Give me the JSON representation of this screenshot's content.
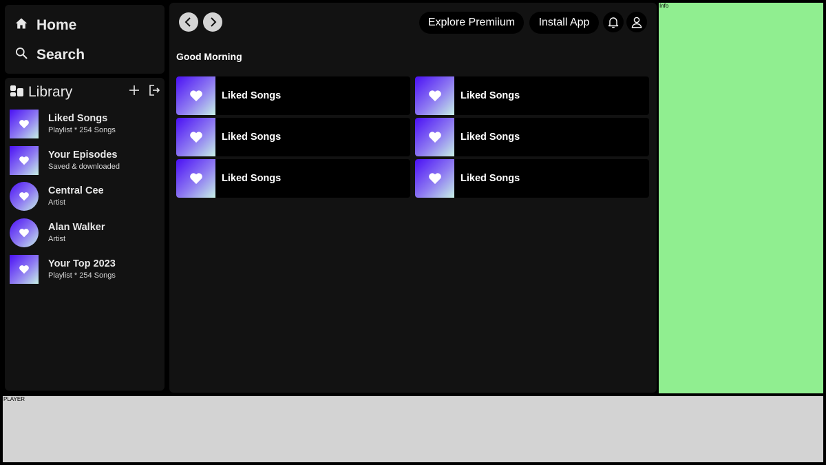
{
  "nav": {
    "home_label": "Home",
    "home_icon": "home-icon",
    "search_label": "Search",
    "search_icon": "search-icon"
  },
  "library": {
    "title": "Library",
    "icon": "library-icon",
    "actions": [
      "add-icon",
      "logout-icon"
    ],
    "items": [
      {
        "title": "Liked Songs",
        "subtitle": "Playlist * 254 Songs",
        "shape": "square"
      },
      {
        "title": "Your Episodes",
        "subtitle": "Saved & downloaded",
        "shape": "square"
      },
      {
        "title": "Central Cee",
        "subtitle": "Artist",
        "shape": "round"
      },
      {
        "title": "Alan Walker",
        "subtitle": "Artist",
        "shape": "round"
      },
      {
        "title": "Your Top 2023",
        "subtitle": "Playlist * 254 Songs",
        "shape": "square"
      }
    ]
  },
  "header": {
    "back_icon": "chevron-left-icon",
    "forward_icon": "chevron-right-icon",
    "explore_label": "Explore Premiium",
    "install_label": "Install App",
    "bell_icon": "bell-icon",
    "user_icon": "user-icon"
  },
  "main": {
    "greeting": "Good Morning",
    "cards": [
      {
        "label": "Liked Songs"
      },
      {
        "label": "Liked Songs"
      },
      {
        "label": "Liked Songs"
      },
      {
        "label": "Liked Songs"
      },
      {
        "label": "Liked Songs"
      },
      {
        "label": "Liked Songs"
      }
    ]
  },
  "info": {
    "label": "Info"
  },
  "player": {
    "label": "PLAYER"
  },
  "colors": {
    "background": "#000000",
    "panel": "#121212",
    "info_panel": "#90ee90",
    "player_bar": "#d3d3d3",
    "gradient_start": "#4a10f5",
    "gradient_end": "#c7f0e6"
  }
}
